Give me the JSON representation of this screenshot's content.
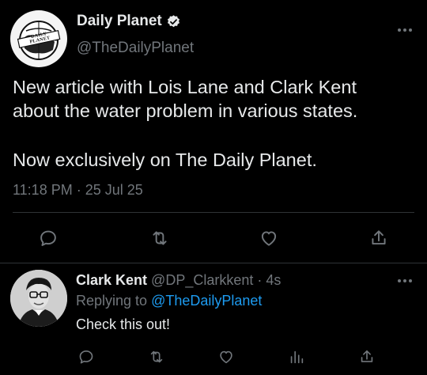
{
  "main_tweet": {
    "display_name": "Daily Planet",
    "handle": "@TheDailyPlanet",
    "text_line1": "New article with Lois Lane and Clark Kent",
    "text_line2": "about the water problem in various states.",
    "text_line3": "Now exclusively on The Daily Planet.",
    "timestamp": "11:18 PM · 25 Jul 25",
    "logo_text": "DAILY PLANET",
    "verified": true
  },
  "reply": {
    "display_name": "Clark Kent",
    "handle": "@DP_Clarkkent",
    "age": "· 4s",
    "replying_prefix": "Replying to",
    "replying_handle": "@TheDailyPlanet",
    "text": "Check this out!"
  },
  "icons": {
    "main_actions": [
      "reply-icon",
      "retweet-icon",
      "like-icon",
      "share-icon"
    ],
    "reply_actions": [
      "reply-icon",
      "retweet-icon",
      "like-icon",
      "views-icon",
      "share-icon"
    ]
  },
  "colors": {
    "background": "#000000",
    "text": "#e7e9ea",
    "muted": "#71767b",
    "accent": "#1d9bf0"
  }
}
